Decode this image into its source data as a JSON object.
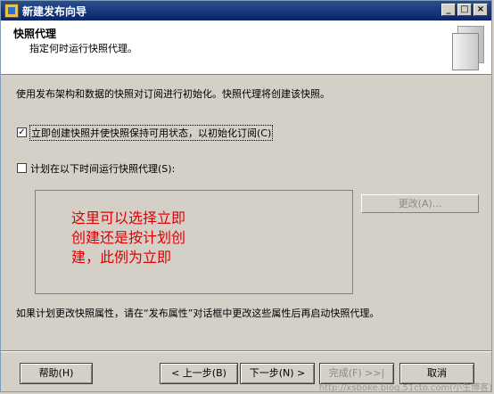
{
  "window": {
    "title": "新建发布向导"
  },
  "header": {
    "title": "快照代理",
    "subtitle": "指定何时运行快照代理。"
  },
  "content": {
    "intro": "使用发布架构和数据的快照对订阅进行初始化。快照代理将创建该快照。",
    "option_immediate": {
      "label": "立即创建快照并使快照保持可用状态，以初始化订阅(C)",
      "checked": true
    },
    "option_schedule": {
      "label": "计划在以下时间运行快照代理(S):",
      "checked": false
    },
    "annotation_lines": [
      "这里可以选择立即",
      "创建还是按计划创",
      "建，此例为立即"
    ],
    "change_button": "更改(A)...",
    "note": "如果计划更改快照属性，请在“发布属性”对话框中更改这些属性后再启动快照代理。"
  },
  "buttons": {
    "help": "帮助(H)",
    "back": "< 上一步(B)",
    "next": "下一步(N) >",
    "finish": "完成(F) >>|",
    "cancel": "取消"
  },
  "watermark": "http://xsboke.blog.51cto.com(小生博客)"
}
